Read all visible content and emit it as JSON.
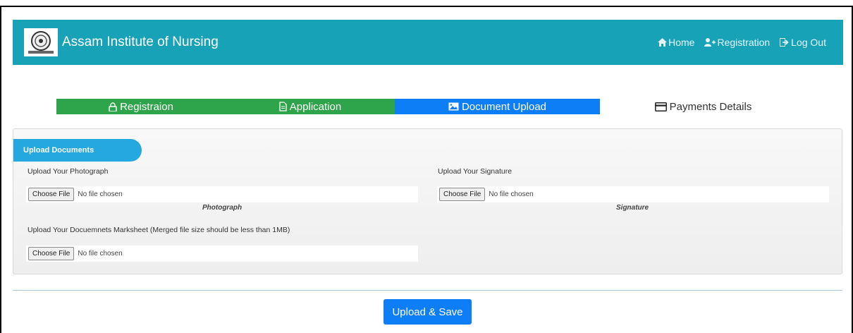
{
  "header": {
    "brand_title": "Assam Institute of Nursing",
    "nav": {
      "home": "Home",
      "registration": "Registration",
      "logout": "Log Out"
    }
  },
  "steps": {
    "registration": "Registraion",
    "application": "Application",
    "document_upload": "Document Upload",
    "payments": "Payments Details"
  },
  "upload_card": {
    "tab_title": "Upload Documents",
    "photograph": {
      "label": "Upload Your Photograph",
      "button": "Choose File",
      "status": "No file chosen",
      "caption": "Photograph"
    },
    "signature": {
      "label": "Upload Your Signature",
      "button": "Choose File",
      "status": "No file chosen",
      "caption": "Signature"
    },
    "marksheet": {
      "label": "Upload Your Docuemnets Marksheet (Merged file size should be less than 1MB)",
      "button": "Choose File",
      "status": "No file chosen"
    }
  },
  "actions": {
    "save": "Upload & Save"
  },
  "colors": {
    "navbar": "#17a2b8",
    "step_done": "#2ea54a",
    "step_active": "#0d7ef5",
    "tab": "#25a8e0",
    "primary_button": "#0d7ef5"
  }
}
